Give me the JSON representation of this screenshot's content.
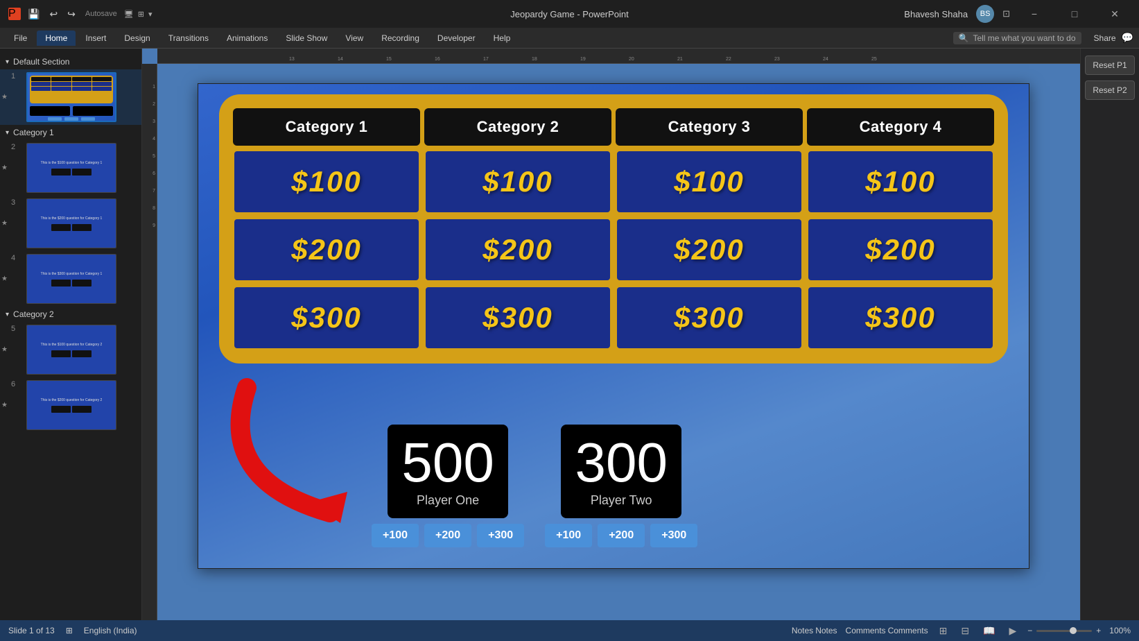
{
  "titlebar": {
    "app_title": "Jeopardy Game - PowerPoint",
    "user_name": "Bhavesh Shaha",
    "minimize_label": "−",
    "maximize_label": "□",
    "close_label": "✕",
    "share_label": "Share"
  },
  "ribbon": {
    "tabs": [
      "File",
      "Home",
      "Insert",
      "Design",
      "Transitions",
      "Animations",
      "Slide Show",
      "View",
      "Recording",
      "Developer",
      "Help"
    ],
    "active_tab": "Home",
    "search_placeholder": "Tell me what you want to do"
  },
  "sidebar": {
    "sections": [
      {
        "name": "Default Section",
        "slides": [
          {
            "num": "1",
            "active": true
          }
        ]
      },
      {
        "name": "Category 1",
        "slides": [
          {
            "num": "2"
          },
          {
            "num": "3"
          },
          {
            "num": "4"
          }
        ]
      },
      {
        "name": "Category 2",
        "slides": [
          {
            "num": "5"
          },
          {
            "num": "6"
          }
        ]
      }
    ]
  },
  "slide": {
    "board": {
      "categories": [
        "Category 1",
        "Category 2",
        "Category 3",
        "Category 4"
      ],
      "values": [
        "$100",
        "$200",
        "$300"
      ]
    },
    "players": [
      {
        "name": "Player One",
        "score": "500",
        "buttons": [
          "+100",
          "+200",
          "+300"
        ]
      },
      {
        "name": "Player Two",
        "score": "300",
        "buttons": [
          "+100",
          "+200",
          "+300"
        ]
      }
    ]
  },
  "right_panel": {
    "buttons": [
      "Reset P1",
      "Reset P2"
    ]
  },
  "statusbar": {
    "slide_info": "Slide 1 of 13",
    "language": "English (India)",
    "notes_label": "Notes",
    "comments_label": "Comments",
    "zoom_level": "100%",
    "zoom_minus": "−",
    "zoom_plus": "+"
  }
}
